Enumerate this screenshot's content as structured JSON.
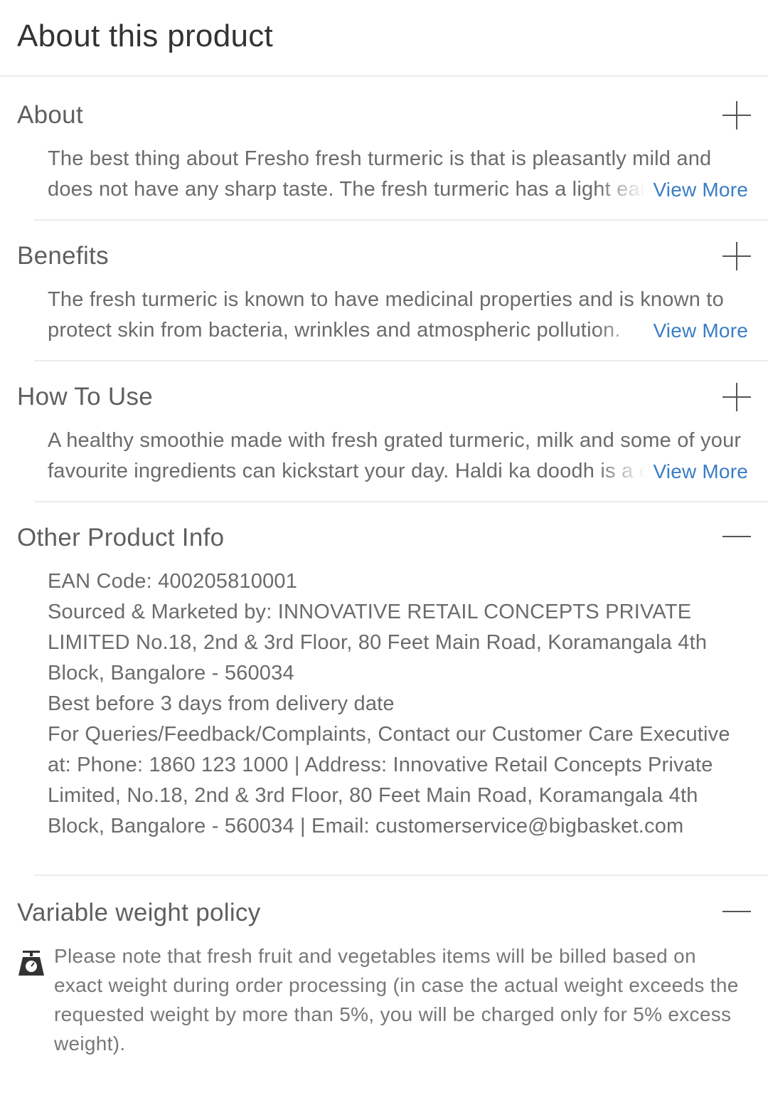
{
  "header": {
    "title": "About this product"
  },
  "sections": [
    {
      "title": "About",
      "text": "The best thing about Fresho fresh turmeric is that is pleasantly mild and does not have any sharp taste. The fresh turmeric has a light earthy aroma and flavour.",
      "view_more": "View More"
    },
    {
      "title": "Benefits",
      "text": "The fresh turmeric is known to have medicinal properties and is known to protect skin from bacteria, wrinkles and atmospheric pollution.",
      "view_more": "View More"
    },
    {
      "title": "How To Use",
      "text": "A healthy smoothie made with fresh grated turmeric, milk and some of your favourite ingredients can kickstart your day. Haldi ka doodh is a classic.",
      "view_more": "View More"
    }
  ],
  "other_info": {
    "title": "Other Product Info",
    "lines": [
      "EAN Code: 400205810001",
      "Sourced & Marketed by: INNOVATIVE RETAIL CONCEPTS PRIVATE LIMITED No.18, 2nd & 3rd Floor, 80 Feet Main Road, Koramangala 4th Block, Bangalore - 560034",
      "Best before 3 days from delivery date",
      "For Queries/Feedback/Complaints, Contact our Customer Care Executive at: Phone: 1860 123 1000 | Address: Innovative Retail Concepts Private Limited, No.18, 2nd & 3rd Floor, 80 Feet Main Road, Koramangala 4th Block, Bangalore - 560034 | Email: customerservice@bigbasket.com"
    ]
  },
  "policy": {
    "title": "Variable weight policy",
    "text": "Please note that fresh fruit and vegetables items will be billed based on exact weight during order processing (in case the actual weight exceeds the requested weight by more than 5%, you will be charged only for 5% excess weight).",
    "icon": "weighing-scale-icon"
  },
  "colors": {
    "link": "#3a7dc4",
    "divider": "#ececec"
  }
}
